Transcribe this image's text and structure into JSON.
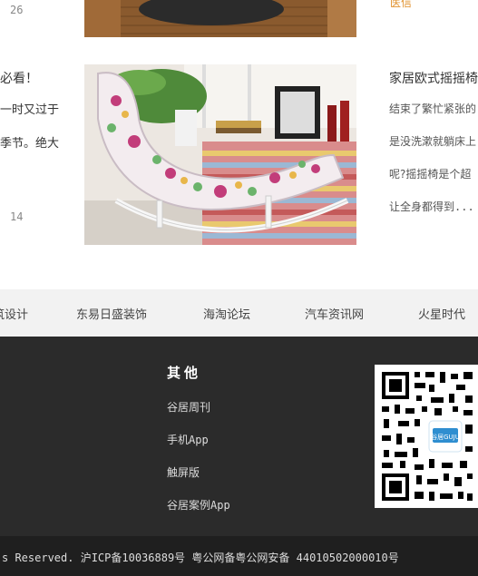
{
  "articles": {
    "top_count": "26",
    "left_title": "必看！",
    "left_line1": "一时又过于",
    "left_line2": "季节。绝大",
    "left_count": "14",
    "right_top_snippet": "医信                    ",
    "right_title": "家居欧式摇摇椅",
    "right_line1": "结束了繁忙紧张的",
    "right_line2": "是没洗漱就躺床上",
    "right_line3": "呢?摇摇椅是个超",
    "right_line4": "让全身都得到..."
  },
  "links": {
    "items": [
      "筑设计",
      "东易日盛装饰",
      "海淘论坛",
      "汽车资讯网",
      "火星时代"
    ]
  },
  "footer": {
    "title": "其他",
    "items": [
      "谷居周刊",
      "手机App",
      "触屏版",
      "谷居案例App"
    ],
    "qr_logo": "谷居GUJU"
  },
  "copyright": {
    "text": "s Reserved. 沪ICP备10036889号 粤公网备粤公网安备 44010502000010号"
  }
}
